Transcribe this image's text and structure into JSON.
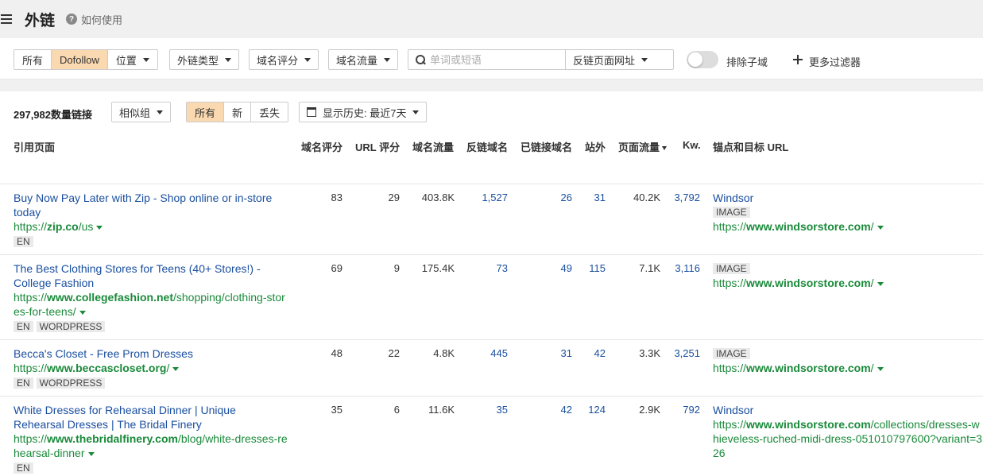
{
  "header": {
    "title": "外链",
    "help_label": "如何使用"
  },
  "filters": {
    "link_type_tabs": [
      {
        "label": "所有",
        "active": false
      },
      {
        "label": "Dofollow",
        "active": true
      }
    ],
    "position_label": "位置",
    "backlink_type_label": "外链类型",
    "dr_label": "域名评分",
    "traffic_label": "域名流量",
    "search_placeholder": "单词或短语",
    "search_mode_label": "反链页面网址",
    "exclude_subdomains_label": "排除子域",
    "more_filters_label": "更多过滤器"
  },
  "results": {
    "count_label": "297,982数量链接",
    "group_label": "相似组",
    "state_tabs": [
      {
        "label": "所有",
        "active": true
      },
      {
        "label": "新",
        "active": false
      },
      {
        "label": "丢失",
        "active": false
      }
    ],
    "history_label": "显示历史: 最近7天"
  },
  "columns": {
    "ref_page": "引用页面",
    "dr": "域名评分",
    "ur": "URL 评分",
    "domain_traffic": "域名流量",
    "ref_domains": "反链域名",
    "linked_domains": "已链接域名",
    "ext": "站外",
    "page_traffic": "页面流量",
    "kw": "Kw.",
    "anchor": "锚点和目标 URL"
  },
  "rows": [
    {
      "title": "Buy Now Pay Later with Zip - Shop online or in-store today",
      "url_pre": "https://",
      "url_domain": "zip.co",
      "url_path": "/us",
      "tags": [
        "EN"
      ],
      "dr": "83",
      "ur": "29",
      "domain_traffic": "403.8K",
      "ref_domains": "1,527",
      "linked_domains": "26",
      "ext": "31",
      "page_traffic": "40.2K",
      "kw": "3,792",
      "anchor_text": "Windsor",
      "anchor_tag": "IMAGE",
      "target_pre": "https://",
      "target_domain": "www.windsorstore.com",
      "target_path": "/"
    },
    {
      "title": "The Best Clothing Stores for Teens (40+ Stores!) - College Fashion",
      "url_pre": "https://",
      "url_domain": "www.collegefashion.net",
      "url_path": "/shopping/clothing-stores-for-teens/",
      "tags": [
        "EN",
        "WORDPRESS"
      ],
      "dr": "69",
      "ur": "9",
      "domain_traffic": "175.4K",
      "ref_domains": "73",
      "linked_domains": "49",
      "ext": "115",
      "page_traffic": "7.1K",
      "kw": "3,116",
      "anchor_text": "",
      "anchor_tag": "IMAGE",
      "target_pre": "https://",
      "target_domain": "www.windsorstore.com",
      "target_path": "/"
    },
    {
      "title": "Becca's Closet - Free Prom Dresses",
      "url_pre": "https://",
      "url_domain": "www.beccascloset.org",
      "url_path": "/",
      "tags": [
        "EN",
        "WORDPRESS"
      ],
      "dr": "48",
      "ur": "22",
      "domain_traffic": "4.8K",
      "ref_domains": "445",
      "linked_domains": "31",
      "ext": "42",
      "page_traffic": "3.3K",
      "kw": "3,251",
      "anchor_text": "",
      "anchor_tag": "IMAGE",
      "target_pre": "https://",
      "target_domain": "www.windsorstore.com",
      "target_path": "/"
    },
    {
      "title": "White Dresses for Rehearsal Dinner | Unique Rehearsal Dresses | The Bridal Finery",
      "url_pre": "https://",
      "url_domain": "www.thebridalfinery.com",
      "url_path": "/blog/white-dresses-rehearsal-dinner",
      "tags": [
        "EN"
      ],
      "dr": "35",
      "ur": "6",
      "domain_traffic": "11.6K",
      "ref_domains": "35",
      "linked_domains": "42",
      "ext": "124",
      "page_traffic": "2.9K",
      "kw": "792",
      "anchor_text": "Windsor",
      "anchor_tag": "",
      "target_pre": "https://",
      "target_domain": "www.windsorstore.com",
      "target_path": "/collections/dresses-whieveless-ruched-midi-dress-051010797600?variant=326"
    }
  ]
}
